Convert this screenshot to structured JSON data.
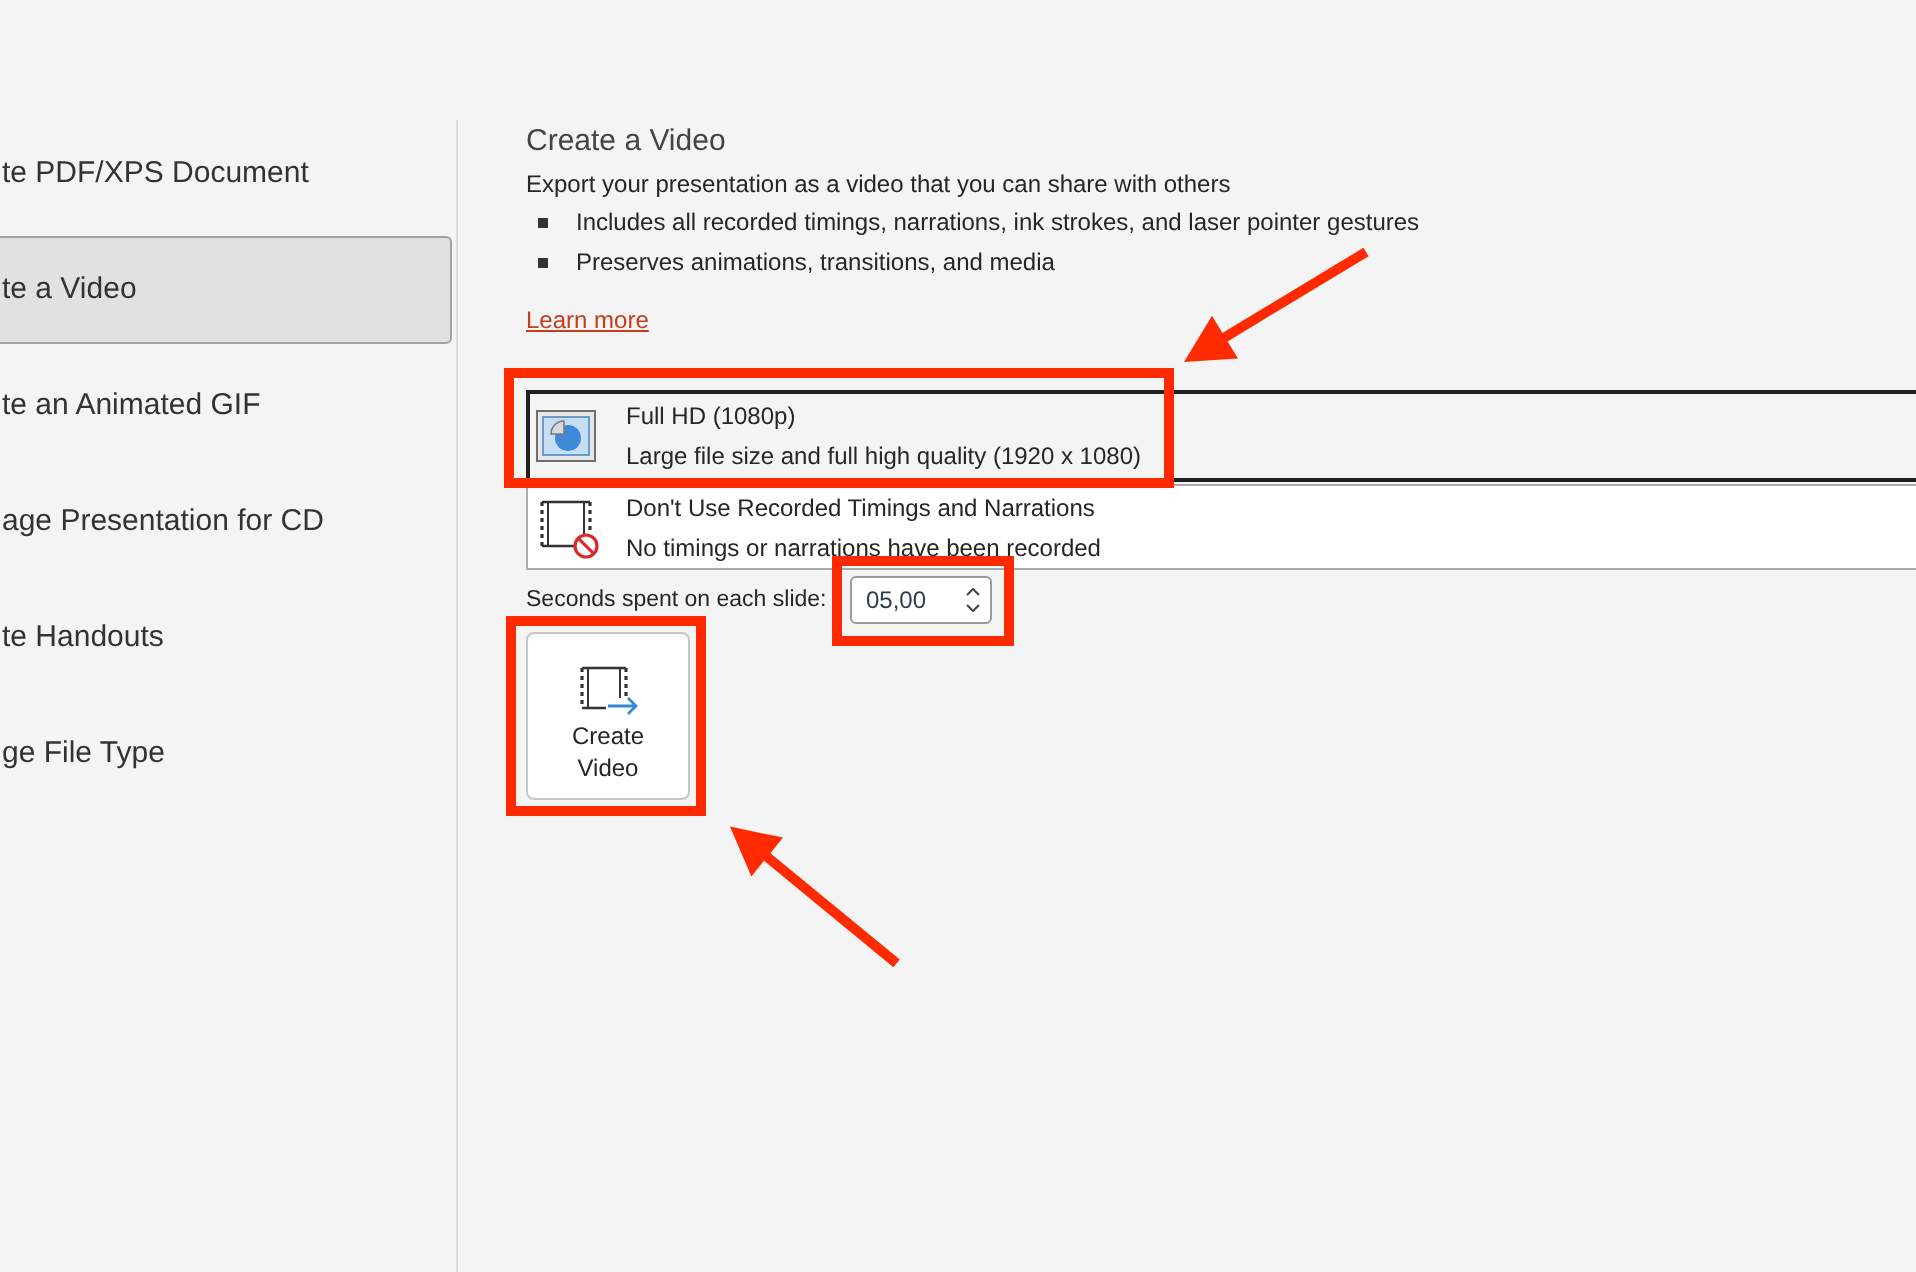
{
  "sidebar": {
    "items": [
      {
        "label": "te PDF/XPS Document",
        "selected": false
      },
      {
        "label": "te a Video",
        "selected": true
      },
      {
        "label": "te an Animated GIF",
        "selected": false
      },
      {
        "label": "age Presentation for CD",
        "selected": false
      },
      {
        "label": "te Handouts",
        "selected": false
      },
      {
        "label": "ge File Type",
        "selected": false
      }
    ]
  },
  "panel": {
    "title": "Create a Video",
    "description": "Export your presentation as a video that you can share with others",
    "bullets": [
      "Includes all recorded timings, narrations, ink strokes, and laser pointer gestures",
      "Preserves animations, transitions, and media"
    ],
    "link": "Learn more"
  },
  "dropdowns": [
    {
      "kind": "quality",
      "title": "Full HD (1080p)",
      "subtitle": "Large file size and full high quality (1920 x 1080)",
      "focused": true,
      "highlighted": true,
      "pointed_at": true
    },
    {
      "kind": "timings",
      "title": "Don't Use Recorded Timings and Narrations",
      "subtitle": "No timings or narrations have been recorded",
      "focused": false,
      "highlighted": false,
      "pointed_at": false
    }
  ],
  "seconds_field": {
    "label": "Seconds spent on each slide:",
    "value": "05,00",
    "highlighted": true,
    "pointed_at": false
  },
  "create_button": {
    "label": "Create Video",
    "highlighted": true,
    "pointed_at": true
  }
}
